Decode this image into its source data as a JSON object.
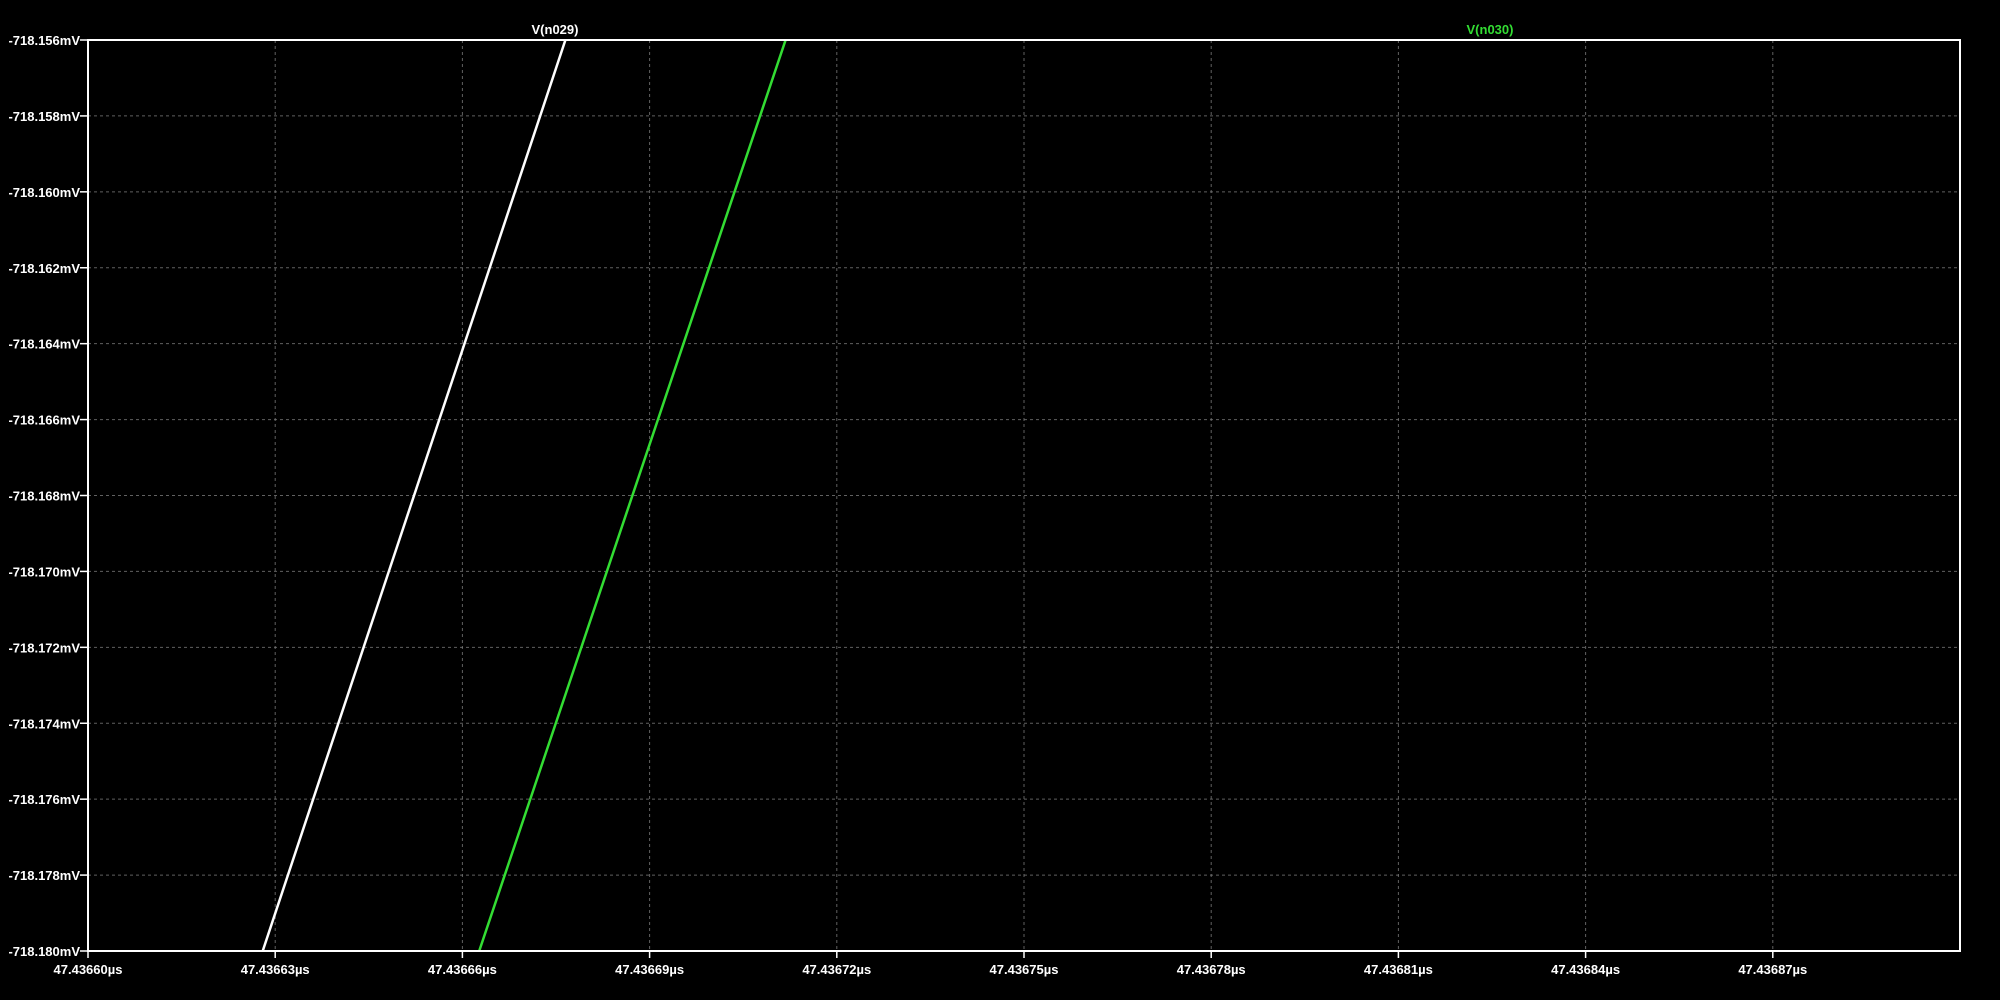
{
  "chart_data": {
    "type": "line",
    "title": "",
    "xlabel": "",
    "ylabel": "",
    "grid": true,
    "legend_placement": "top",
    "xlim": [
      47.4366,
      47.4369
    ],
    "ylim": [
      -718.18,
      -718.156
    ],
    "x_ticks": [
      {
        "value": 47.4366,
        "label": "47.43660µs"
      },
      {
        "value": 47.43663,
        "label": "47.43663µs"
      },
      {
        "value": 47.43666,
        "label": "47.43666µs"
      },
      {
        "value": 47.43669,
        "label": "47.43669µs"
      },
      {
        "value": 47.43672,
        "label": "47.43672µs"
      },
      {
        "value": 47.43675,
        "label": "47.43675µs"
      },
      {
        "value": 47.43678,
        "label": "47.43678µs"
      },
      {
        "value": 47.43681,
        "label": "47.43681µs"
      },
      {
        "value": 47.43684,
        "label": "47.43684µs"
      },
      {
        "value": 47.43687,
        "label": "47.43687µs"
      }
    ],
    "y_ticks": [
      {
        "value": -718.156,
        "label": "-718.156mV"
      },
      {
        "value": -718.158,
        "label": "-718.158mV"
      },
      {
        "value": -718.16,
        "label": "-718.160mV"
      },
      {
        "value": -718.162,
        "label": "-718.162mV"
      },
      {
        "value": -718.164,
        "label": "-718.164mV"
      },
      {
        "value": -718.166,
        "label": "-718.166mV"
      },
      {
        "value": -718.168,
        "label": "-718.168mV"
      },
      {
        "value": -718.17,
        "label": "-718.170mV"
      },
      {
        "value": -718.172,
        "label": "-718.172mV"
      },
      {
        "value": -718.174,
        "label": "-718.174mV"
      },
      {
        "value": -718.176,
        "label": "-718.176mV"
      },
      {
        "value": -718.178,
        "label": "-718.178mV"
      },
      {
        "value": -718.18,
        "label": "-718.180mV"
      }
    ],
    "series": [
      {
        "name": "V(n029)",
        "color": "#ffffff",
        "x": [
          47.436628,
          47.4366765
        ],
        "y": [
          -718.18,
          -718.156
        ]
      },
      {
        "name": "V(n030)",
        "color": "#33dd33",
        "x": [
          47.4366627,
          47.4367118
        ],
        "y": [
          -718.18,
          -718.156
        ]
      }
    ]
  }
}
